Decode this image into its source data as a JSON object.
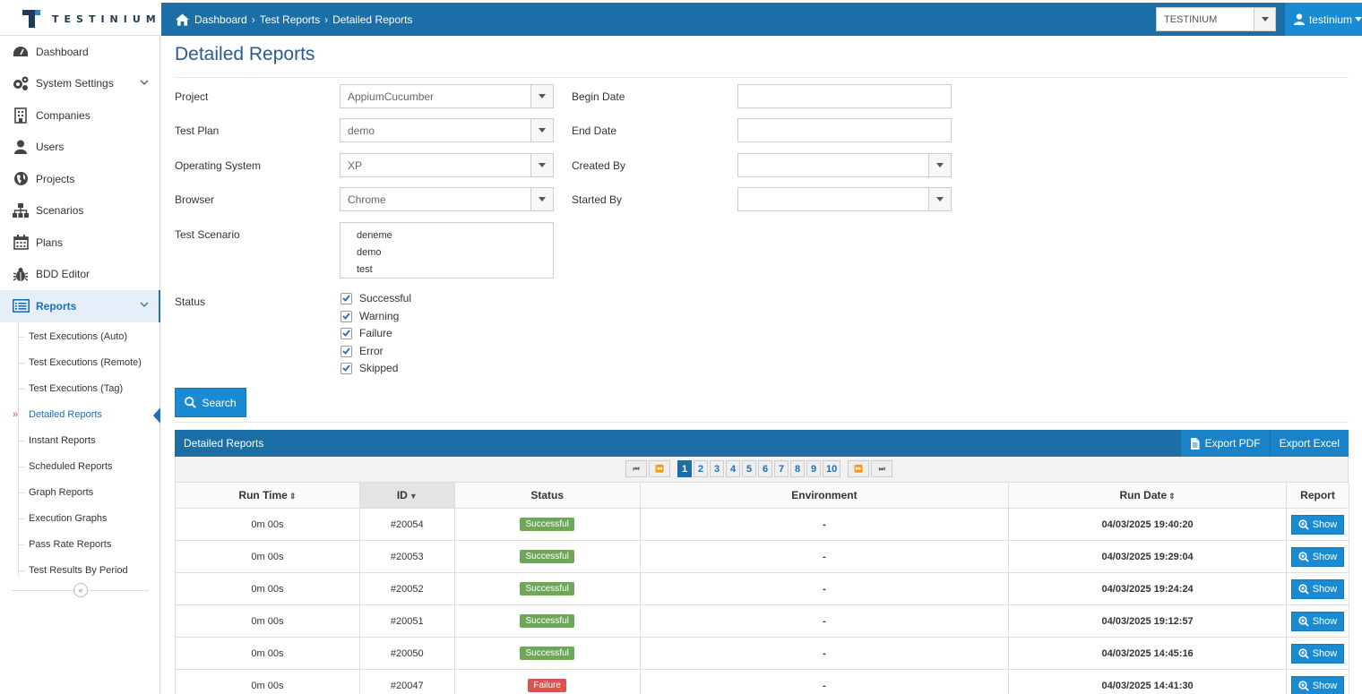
{
  "brand": {
    "logo_text": "TESTINIUM"
  },
  "breadcrumb": [
    "Dashboard",
    "Test Reports",
    "Detailed Reports"
  ],
  "header": {
    "company_select": "TESTINIUM",
    "user": "testinium"
  },
  "sidebar": {
    "items": [
      {
        "label": "Dashboard",
        "icon": "dashboard-icon"
      },
      {
        "label": "System Settings",
        "icon": "gears-icon"
      },
      {
        "label": "Companies",
        "icon": "building-icon"
      },
      {
        "label": "Users",
        "icon": "user-icon"
      },
      {
        "label": "Projects",
        "icon": "globe-icon"
      },
      {
        "label": "Scenarios",
        "icon": "sitemap-icon"
      },
      {
        "label": "Plans",
        "icon": "calendar-icon"
      },
      {
        "label": "BDD Editor",
        "icon": "bug-icon"
      },
      {
        "label": "Reports",
        "icon": "list-icon"
      }
    ],
    "submenu": [
      "Test Executions (Auto)",
      "Test Executions (Remote)",
      "Test Executions (Tag)",
      "Detailed Reports",
      "Instant Reports",
      "Scheduled Reports",
      "Graph Reports",
      "Execution Graphs",
      "Pass Rate Reports",
      "Test Results By Period"
    ],
    "collapse_icon": "«"
  },
  "page": {
    "title": "Detailed Reports"
  },
  "form": {
    "project_label": "Project",
    "project_value": "AppiumCucumber",
    "test_plan_label": "Test Plan",
    "test_plan_value": "demo",
    "os_label": "Operating System",
    "os_value": "XP",
    "browser_label": "Browser",
    "browser_value": "Chrome",
    "scenario_label": "Test Scenario",
    "scenarios": [
      "deneme",
      "demo",
      "test"
    ],
    "status_label": "Status",
    "statuses": [
      "Successful",
      "Warning",
      "Failure",
      "Error",
      "Skipped"
    ],
    "begin_date_label": "Begin Date",
    "begin_date_value": "",
    "end_date_label": "End Date",
    "end_date_value": "",
    "created_by_label": "Created By",
    "created_by_value": "",
    "started_by_label": "Started By",
    "started_by_value": "",
    "search_label": "Search"
  },
  "panel": {
    "title": "Detailed Reports",
    "export_pdf": "Export PDF",
    "export_excel": "Export Excel",
    "pages": [
      "1",
      "2",
      "3",
      "4",
      "5",
      "6",
      "7",
      "8",
      "9",
      "10"
    ],
    "current_page": "1",
    "pager_first": "⏮",
    "pager_prev": "⏪",
    "pager_next": "⏩",
    "pager_last": "⏭"
  },
  "table": {
    "columns": [
      "Run Time",
      "ID",
      "Status",
      "Environment",
      "Run Date",
      "Report"
    ],
    "show_label": "Show",
    "rows": [
      {
        "run_time": "0m 00s",
        "id": "#20054",
        "status": "Successful",
        "environment": "-",
        "run_date": "04/03/2025 19:40:20"
      },
      {
        "run_time": "0m 00s",
        "id": "#20053",
        "status": "Successful",
        "environment": "-",
        "run_date": "04/03/2025 19:29:04"
      },
      {
        "run_time": "0m 00s",
        "id": "#20052",
        "status": "Successful",
        "environment": "-",
        "run_date": "04/03/2025 19:24:24"
      },
      {
        "run_time": "0m 00s",
        "id": "#20051",
        "status": "Successful",
        "environment": "-",
        "run_date": "04/03/2025 19:12:57"
      },
      {
        "run_time": "0m 00s",
        "id": "#20050",
        "status": "Successful",
        "environment": "-",
        "run_date": "04/03/2025 14:45:16"
      },
      {
        "run_time": "0m 00s",
        "id": "#20047",
        "status": "Failure",
        "environment": "-",
        "run_date": "04/03/2025 14:41:30"
      }
    ]
  },
  "colors": {
    "primary": "#1b6ea6",
    "accent": "#1a8ad2",
    "success": "#6fa75a",
    "failure": "#d9534f"
  }
}
